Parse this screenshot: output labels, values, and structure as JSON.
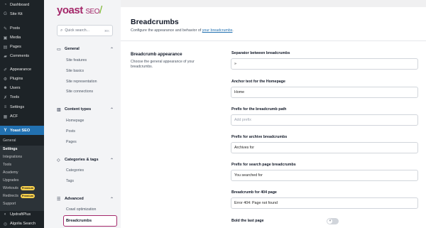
{
  "wp_menu": {
    "items": [
      {
        "label": "Dashboard",
        "icon": "dashboard-icon"
      },
      {
        "label": "Site Kit",
        "icon": "sitekit-icon"
      },
      {
        "label": "Posts",
        "icon": "pin-icon"
      },
      {
        "label": "Media",
        "icon": "media-icon"
      },
      {
        "label": "Pages",
        "icon": "pages-icon"
      },
      {
        "label": "Comments",
        "icon": "comments-icon"
      },
      {
        "label": "Appearance",
        "icon": "brush-icon"
      },
      {
        "label": "Plugins",
        "icon": "plugin-icon"
      },
      {
        "label": "Users",
        "icon": "users-icon"
      },
      {
        "label": "Tools",
        "icon": "wrench-icon"
      },
      {
        "label": "Settings",
        "icon": "settings-icon"
      },
      {
        "label": "ACF",
        "icon": "acf-icon"
      },
      {
        "label": "Yoast SEO",
        "icon": "yoast-icon"
      }
    ],
    "submenu": {
      "general": "General",
      "settings": "Settings",
      "integrations": "Integrations",
      "tools": "Tools",
      "academy": "Academy",
      "upgrades": "Upgrades",
      "workouts": "Workouts",
      "redirects": "Redirects",
      "support": "Support",
      "premium_badge": "Premium"
    },
    "updraft": "UpdraftPlus",
    "algolia": "Algolia Search"
  },
  "yoast_nav": {
    "logo_main": "yoast",
    "logo_seo": "SEO",
    "logo_slash": "/",
    "search_placeholder": "Quick search...",
    "search_shortcut": "⌘K",
    "groups": [
      {
        "label": "General",
        "links": [
          "Site features",
          "Site basics",
          "Site representation",
          "Site connections"
        ]
      },
      {
        "label": "Content types",
        "links": [
          "Homepage",
          "Posts",
          "Pages"
        ]
      },
      {
        "label": "Categories & tags",
        "links": [
          "Categories",
          "Tags"
        ]
      },
      {
        "label": "Advanced",
        "links": [
          "Crawl optimization",
          "Breadcrumbs"
        ]
      }
    ]
  },
  "page": {
    "title": "Breadcrumbs",
    "description": "Configure the appearance and behavior of ",
    "description_link": "your breadcrumbs",
    "description_end": ".",
    "section_title": "Breadcrumb appearance",
    "section_desc": "Choose the general appearance of your breadcrumbs.",
    "fields": [
      {
        "label": "Separator between breadcrumbs",
        "value": "»",
        "placeholder": false
      },
      {
        "label": "Anchor text for the Homepage",
        "value": "Home",
        "placeholder": false
      },
      {
        "label": "Prefix for the breadcrumb path",
        "value": "Add prefix",
        "placeholder": true
      },
      {
        "label": "Prefix for archive breadcrumbs",
        "value": "Archives for",
        "placeholder": false
      },
      {
        "label": "Prefix for search page breadcrumbs",
        "value": "You searched for",
        "placeholder": false
      },
      {
        "label": "Breadcrumb for 404 page",
        "value": "Error 404: Page not found",
        "placeholder": false
      }
    ],
    "bold_label": "Bold the last page",
    "bold_enabled": false
  },
  "colors": {
    "brand": "#a4286a",
    "wp_accent": "#2271b1",
    "premium": "#fcd34d"
  }
}
